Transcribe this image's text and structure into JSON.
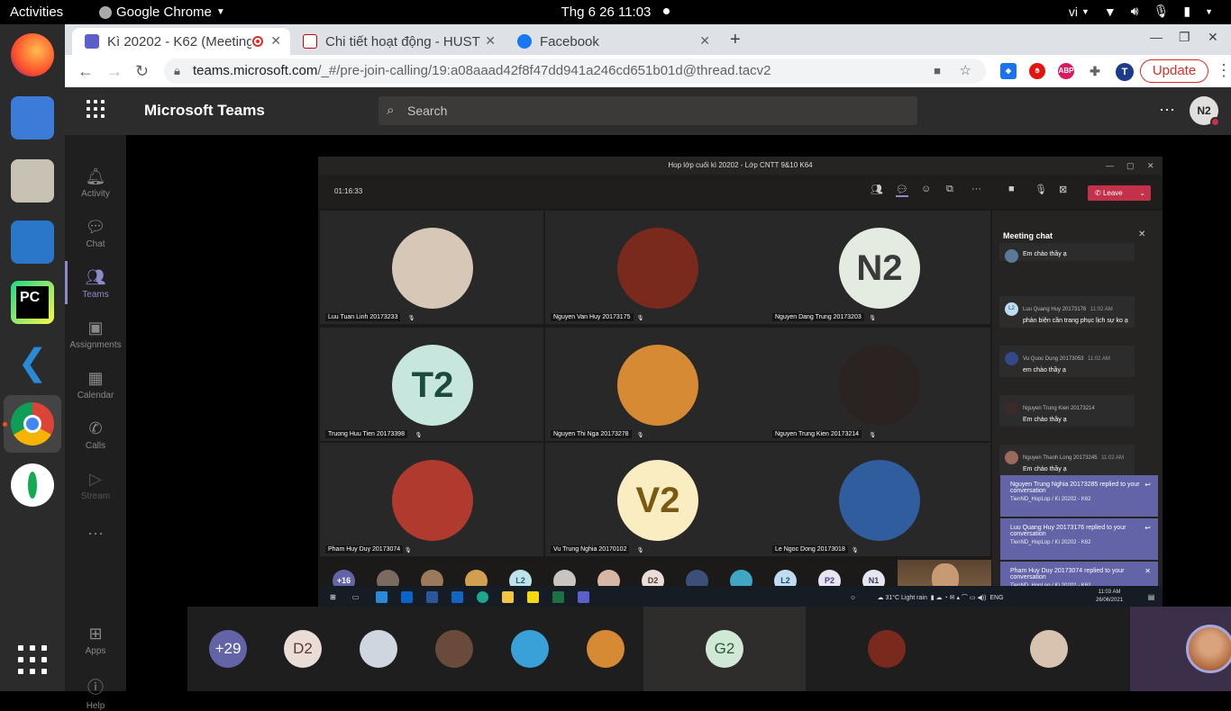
{
  "os": {
    "activities": "Activities",
    "app_name": "Google Chrome",
    "clock": "Thg 6 26  11:03",
    "lang": "vi"
  },
  "browser": {
    "tabs": [
      {
        "title": "Kì 20202 - K62 (Meeting",
        "active": true
      },
      {
        "title": "Chi tiết hoạt động - HUST",
        "active": false
      },
      {
        "title": "Facebook",
        "active": false
      }
    ],
    "url_host": "teams.microsoft.com",
    "url_path": "/_#/pre-join-calling/19:a08aaad42f8f47dd941a246cd651b01d@thread.tacv2",
    "update_label": "Update",
    "profile_letter": "T"
  },
  "teams": {
    "title": "Microsoft Teams",
    "search_placeholder": "Search",
    "user_initials": "N2",
    "rail": [
      {
        "label": "Activity",
        "icon": "bell-icon"
      },
      {
        "label": "Chat",
        "icon": "chat-icon"
      },
      {
        "label": "Teams",
        "icon": "teams-icon"
      },
      {
        "label": "Assignments",
        "icon": "assignments-icon"
      },
      {
        "label": "Calendar",
        "icon": "calendar-icon"
      },
      {
        "label": "Calls",
        "icon": "phone-icon"
      },
      {
        "label": "Stream",
        "icon": "stream-icon"
      },
      {
        "label": "Apps",
        "icon": "apps-icon"
      },
      {
        "label": "Help",
        "icon": "help-icon"
      }
    ]
  },
  "shared": {
    "window_title": "Hop lớp cuối kì 20202 - Lớp CNTT 9&10 K64",
    "timer": "01:16:33",
    "leave": "Leave",
    "participants": [
      {
        "name": "Luu Tuan Linh 20173233",
        "initials": "",
        "bg": "#d7c7b6"
      },
      {
        "name": "Nguyen Van Huy 20173175",
        "initials": "",
        "bg": "#7a2a1c"
      },
      {
        "name": "Nguyen Dang Trung 20173203",
        "initials": "N2",
        "bg": "#e4ebe1",
        "fg": "#3a3a3a"
      },
      {
        "name": "Truong Huu Tien 20173398",
        "initials": "T2",
        "bg": "#c7e6dd",
        "fg": "#1c4a3c"
      },
      {
        "name": "Nguyen Thi Nga 20173278",
        "initials": "",
        "bg": "#d68a34"
      },
      {
        "name": "Nguyen Trung Kien 20173214",
        "initials": "",
        "bg": "#2b2222"
      },
      {
        "name": "Pham Huy Duy 20173074",
        "initials": "",
        "bg": "#b03a2e"
      },
      {
        "name": "Vu Trung Nghia 20170102",
        "initials": "V2",
        "bg": "#fbedc2",
        "fg": "#7a5a10"
      },
      {
        "name": "Le Ngoc Dong 20173018",
        "initials": "",
        "bg": "#2f5d9e"
      }
    ],
    "strip": [
      {
        "t": "+16",
        "bg": "#6264a7"
      },
      {
        "t": "",
        "bg": "#7a6a62"
      },
      {
        "t": "",
        "bg": "#9a7a5a"
      },
      {
        "t": "",
        "bg": "#d0a050"
      },
      {
        "t": "L2",
        "bg": "#bfe3ec",
        "fg": "#1d5c6b"
      },
      {
        "t": "",
        "bg": "#c9c4c0"
      },
      {
        "t": "",
        "bg": "#d7b6a5"
      },
      {
        "t": "D2",
        "bg": "#eadcd6",
        "fg": "#5a3a33"
      },
      {
        "t": "",
        "bg": "#3b4f78"
      },
      {
        "t": "",
        "bg": "#3fa7c4"
      },
      {
        "t": "L2",
        "bg": "#bfdcf0",
        "fg": "#1d4c6b"
      },
      {
        "t": "P2",
        "bg": "#e8e4f2",
        "fg": "#4c3d7a"
      },
      {
        "t": "N1",
        "bg": "#e6e6f0",
        "fg": "#3a3a5a"
      }
    ],
    "chat_header": "Meeting chat",
    "messages": [
      {
        "author": "",
        "time": "",
        "text": "Em chào thầy ạ",
        "avatar": "",
        "bg": "#5a7a9a"
      },
      {
        "author": "Luu Quang Huy 20173176",
        "time": "11:02 AM",
        "text": "phản biện cần trang phục lịch sự ko ạ",
        "avatar": "L2",
        "bg": "#bfdcf0"
      },
      {
        "author": "Vu Quoc Dung 20173053",
        "time": "11:02 AM",
        "text": "em chào thầy ạ",
        "avatar": "",
        "bg": "#34498a"
      },
      {
        "author": "Nguyen Trung Kien 20173214",
        "time": "",
        "text": "Em chào thầy ạ",
        "avatar": "",
        "bg": "#3a2a2a"
      },
      {
        "author": "Nguyen Thanh Long 20173245",
        "time": "11:02 AM",
        "text": "Em chào thầy ạ",
        "avatar": "",
        "bg": "#9a6a5a"
      }
    ],
    "notifications": [
      {
        "title": "Nguyen Trung Nghia 20173285 replied to your conversation",
        "sub": "TienND_HopLop / Kì 20202 - K62"
      },
      {
        "title": "Luu Quang Huy 20173176 replied to your conversation",
        "sub": "TienND_HopLop / Kì 20202 - K62"
      },
      {
        "title": "Pham Huy Duy 20173074 replied to your conversation",
        "sub": "TienND_HopLop / Kì 20202 - K62"
      }
    ],
    "tray_text": "31°C  Light rain",
    "tray_lang": "ENG",
    "tray_time": "11:03 AM",
    "tray_date": "26/06/2021"
  },
  "bottom_row": [
    {
      "t": "+29",
      "bg": "#6264a7",
      "fg": "#fff"
    },
    {
      "t": "D2",
      "bg": "#eadcd6",
      "fg": "#5a3a33"
    },
    {
      "t": "",
      "bg": "#cfd6df"
    },
    {
      "t": "",
      "bg": "#6a4a3a"
    },
    {
      "t": "",
      "bg": "#3aa0d8"
    },
    {
      "t": "",
      "bg": "#d68a34"
    },
    {
      "t": "G2",
      "bg": "#cfe9d6",
      "fg": "#265a34"
    },
    {
      "t": "",
      "bg": "#7a2a1c"
    },
    {
      "t": "",
      "bg": "#d8c2b0"
    }
  ]
}
